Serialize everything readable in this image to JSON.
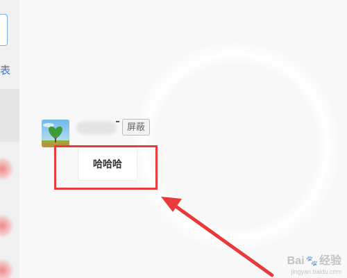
{
  "sidebar": {
    "partial_label": "表"
  },
  "message": {
    "block_button_label": "屏蔽",
    "text": "哈哈哈"
  },
  "colors": {
    "highlight": "#e83a3a",
    "link_blue": "#3b73d6"
  },
  "icons": {
    "avatar": "heart-tree-avatar-icon",
    "arrow": "red-arrow-icon",
    "watermark_paw": "baidu-paw-icon"
  },
  "watermark": {
    "brand": "Bai",
    "brand_cn": "经验",
    "sub": "jingyan.baidu.com"
  }
}
